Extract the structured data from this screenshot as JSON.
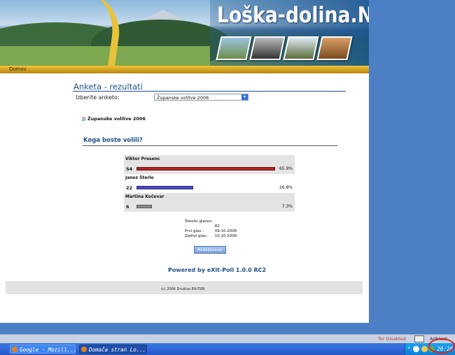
{
  "site": {
    "title": "Loška-dolina.NET",
    "nav": {
      "home": "Domov"
    }
  },
  "poll_page": {
    "heading": "Anketa - rezultati",
    "select_label": "Izberite anketo:",
    "select_value": "Županske volitve 2006",
    "poll_name": "Županske volitve 2006",
    "question": "Koga boste volili?",
    "results": [
      {
        "name": "Viktor Presenc",
        "votes": "54",
        "percent_label": "65.9%",
        "percent": 65.9,
        "color": "#b22222"
      },
      {
        "name": "Janez Šterle",
        "votes": "22",
        "percent_label": "26.8%",
        "percent": 26.8,
        "color": "#4a48c8"
      },
      {
        "name": "Martina Kočevar",
        "votes": "6",
        "percent_label": "7.3%",
        "percent": 7.3,
        "color": "#8a8a8a"
      }
    ],
    "stats": {
      "total_label": "Število glasov :",
      "total_value": "82",
      "first_label": "Prvi glas :",
      "first_value": "09.10.2006",
      "last_label": "Zadnji glas :",
      "last_value": "10.10.2006"
    },
    "continue_button": "Nadaljevanje",
    "powered_by": "Powered by eXit-Poll 1.0.0 RC2",
    "footer": "(c) 2006 Društvo EN-TRN"
  },
  "browser": {
    "status_tor": "Tor Disabled",
    "status_adblock": "Adblock"
  },
  "taskbar": {
    "buttons": [
      {
        "label": "Google - Mozill..."
      },
      {
        "label": "Domača stran Lo..."
      }
    ],
    "tray_arrows": "«",
    "clock": "20:28"
  },
  "colors": {
    "accent_blue": "#1e4e8c",
    "nav_gold": "#e0b030",
    "taskbar": "#2458c8"
  }
}
